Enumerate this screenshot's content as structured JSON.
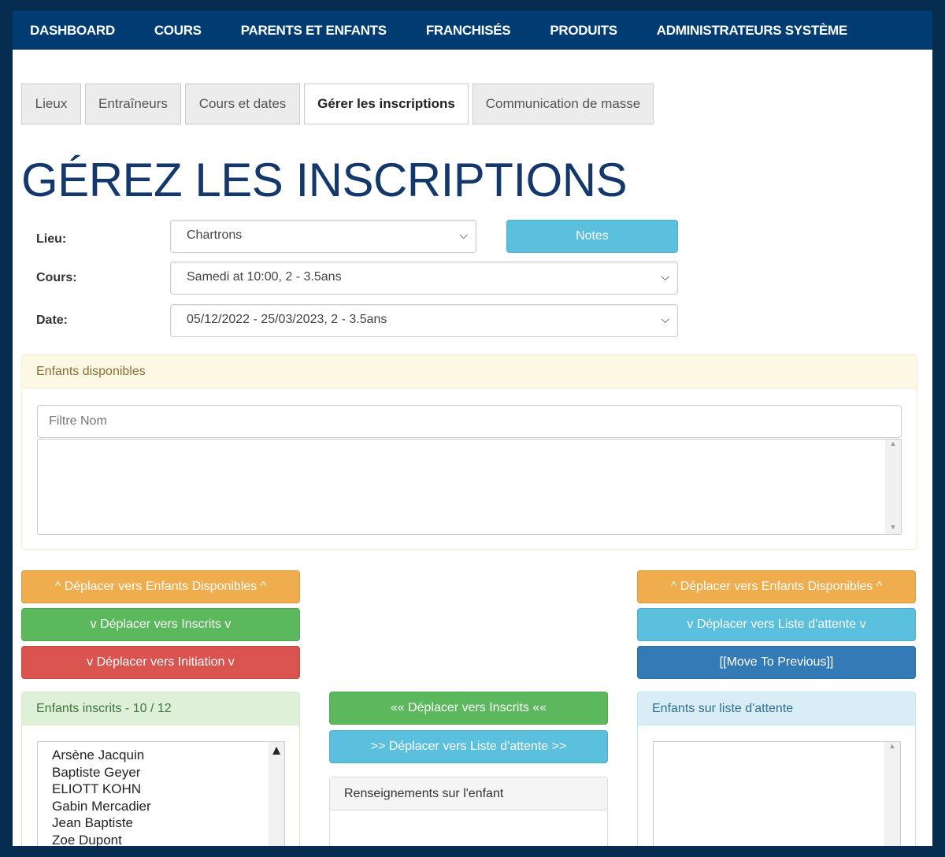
{
  "nav": [
    "DASHBOARD",
    "COURS",
    "PARENTS ET ENFANTS",
    "FRANCHISÉS",
    "PRODUITS",
    "ADMINISTRATEURS SYSTÈME"
  ],
  "tabs": [
    "Lieux",
    "Entraîneurs",
    "Cours et dates",
    "Gérer les inscriptions",
    "Communication de masse"
  ],
  "active_tab": "Gérer les inscriptions",
  "title": "GÉREZ LES INSCRIPTIONS",
  "form": {
    "lieu_label": "Lieu:",
    "lieu_value": "Chartrons",
    "notes": "Notes",
    "cours_label": "Cours:",
    "cours_value": "Samedi at 10:00, 2 - 3.5ans",
    "date_label": "Date:",
    "date_value": "05/12/2022 - 25/03/2023, 2 - 3.5ans"
  },
  "available": {
    "title": "Enfants disponibles",
    "filter_placeholder": "Filtre Nom"
  },
  "left_buttons": [
    "^ Déplacer vers Enfants Disponibles ^",
    "v Déplacer vers Inscrits v",
    "v Déplacer vers Initiation v"
  ],
  "right_buttons": [
    "^ Déplacer vers Enfants Disponibles ^",
    "v Déplacer vers Liste d'attente v",
    "[[Move To Previous]]"
  ],
  "middle_buttons": [
    "«« Déplacer vers Inscrits ««",
    ">> Déplacer vers Liste d'attente >>"
  ],
  "enrolled": {
    "title": "Enfants inscrits - 10 / 12",
    "children": [
      "Arsène Jacquin",
      "Baptiste Geyer",
      "ELIOTT KOHN",
      "Gabin Mercadier",
      "Jean Baptiste",
      "Zoe Dupont"
    ]
  },
  "info_panel": {
    "title": "Renseignements sur l'enfant"
  },
  "waitlist": {
    "title": "Enfants sur liste d'attente"
  },
  "colors": {
    "nav": "#003c71",
    "title": "#14386b",
    "warning": "#f0ad4e",
    "success": "#5cb85c",
    "danger": "#d9534f",
    "info": "#5bc0de",
    "primary": "#337ab7"
  }
}
